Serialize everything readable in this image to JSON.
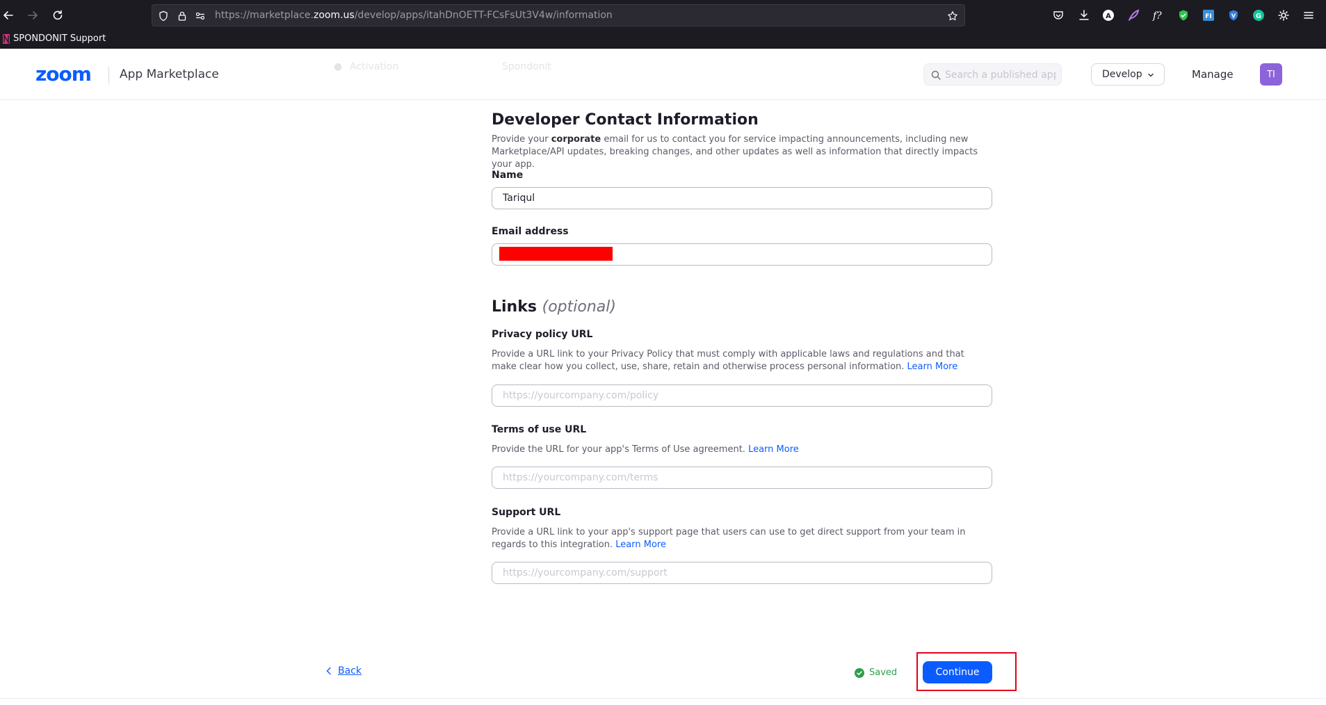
{
  "browser": {
    "url_prefix": "https://marketplace.",
    "url_host": "zoom.us",
    "url_path": "/develop/apps/itahDnOETT-FCsFsUt3V4w/information",
    "bookmark_label": "SPONDONIT Support",
    "extension_icons": [
      "pocket-icon",
      "download-icon",
      "account-icon",
      "feather-icon",
      "formula-icon",
      "shield-check-icon",
      "fi-extension-icon",
      "vpn-shield-icon",
      "grammarly-icon",
      "settings-gear-icon",
      "hamburger-menu-icon"
    ]
  },
  "header": {
    "logo": "zoom",
    "app_name": "App Marketplace",
    "search_placeholder": "Search a published app",
    "develop_label": "Develop",
    "manage_label": "Manage",
    "avatar_initials": "TI",
    "ghost_step_left": "Activation",
    "ghost_step_right": "Spondonit"
  },
  "contact": {
    "title": "Developer Contact Information",
    "desc_before": "Provide your ",
    "desc_bold": "corporate",
    "desc_after": " email for us to contact you for service impacting announcements, including new Marketplace/API updates, breaking changes, and other updates as well as information that directly impacts your app.",
    "name_label": "Name",
    "name_value": "Tariqul",
    "email_label": "Email address",
    "email_value": ""
  },
  "links": {
    "title": "Links",
    "optional": "(optional)",
    "privacy": {
      "label": "Privacy policy URL",
      "desc": "Provide a URL link to your Privacy Policy that must comply with applicable laws and regulations and that make clear how you collect, use, share, retain and otherwise process personal information. ",
      "learn_more": "Learn More",
      "placeholder": "https://yourcompany.com/policy"
    },
    "terms": {
      "label": "Terms of use URL",
      "desc": "Provide the URL for your app's Terms of Use agreement. ",
      "learn_more": "Learn More",
      "placeholder": "https://yourcompany.com/terms"
    },
    "support": {
      "label": "Support URL",
      "desc": "Provide a URL link to your app's support page that users can use to get direct support from your team in regards to this integration. ",
      "learn_more": "Learn More",
      "placeholder": "https://yourcompany.com/support"
    }
  },
  "footer": {
    "back_label": "Back",
    "saved_label": "Saved",
    "continue_label": "Continue"
  },
  "colors": {
    "brand_blue": "#0b5cff",
    "saved_green": "#2ca04c",
    "highlight_red": "#e3001b",
    "redaction_red": "#ff0000"
  }
}
